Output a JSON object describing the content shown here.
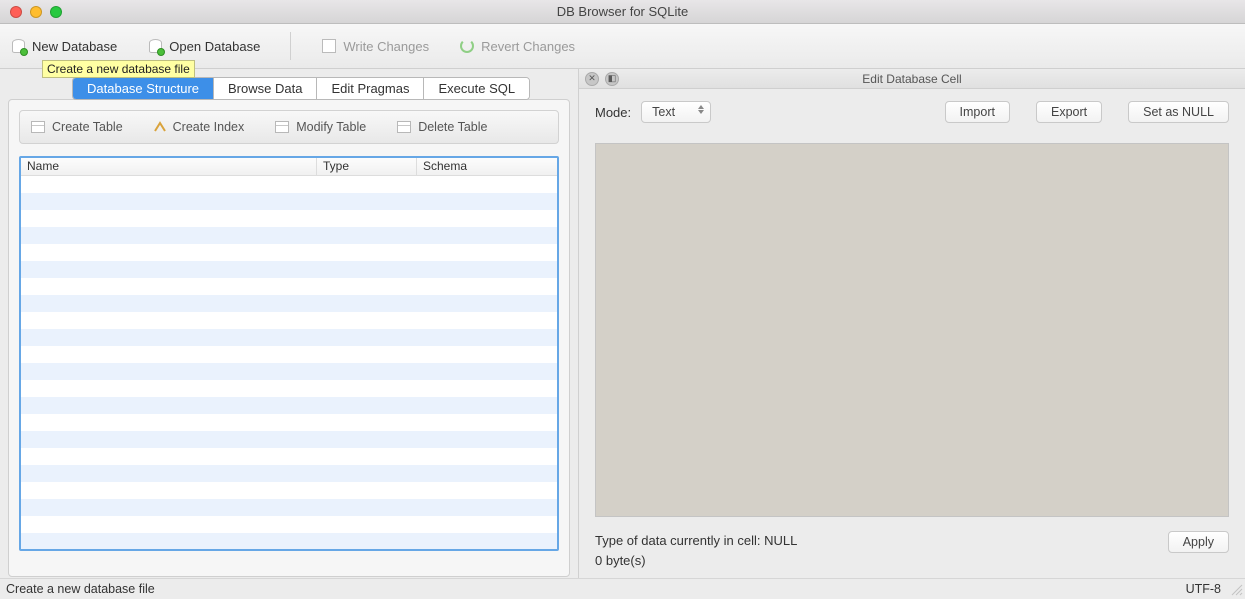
{
  "window": {
    "title": "DB Browser for SQLite"
  },
  "toolbar": {
    "new_database": "New Database",
    "open_database": "Open Database",
    "write_changes": "Write Changes",
    "revert_changes": "Revert Changes",
    "tooltip": "Create a new database file"
  },
  "tabs": {
    "database_structure": "Database Structure",
    "browse_data": "Browse Data",
    "edit_pragmas": "Edit Pragmas",
    "execute_sql": "Execute SQL"
  },
  "structure_toolbar": {
    "create_table": "Create Table",
    "create_index": "Create Index",
    "modify_table": "Modify Table",
    "delete_table": "Delete Table"
  },
  "grid_headers": {
    "name": "Name",
    "type": "Type",
    "schema": "Schema"
  },
  "right_panel": {
    "title": "Edit Database Cell",
    "mode_label": "Mode:",
    "mode_value": "Text",
    "import": "Import",
    "export": "Export",
    "set_null": "Set as NULL",
    "info_type": "Type of data currently in cell: NULL",
    "info_size": "0 byte(s)",
    "apply": "Apply"
  },
  "statusbar": {
    "message": "Create a new database file",
    "encoding": "UTF-8"
  }
}
